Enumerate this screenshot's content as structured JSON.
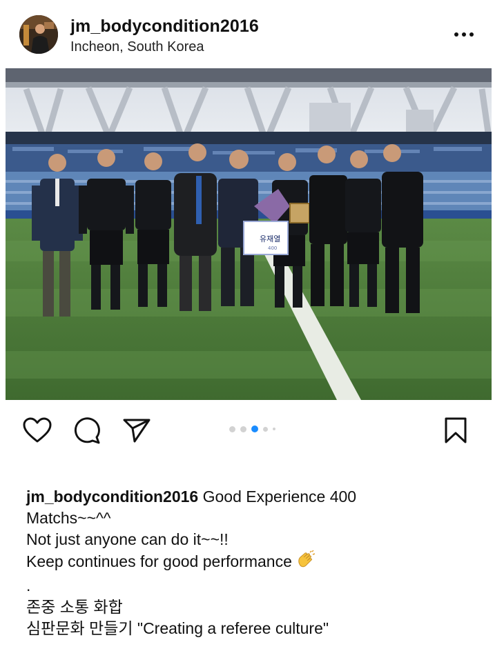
{
  "post": {
    "username": "jm_bodycondition2016",
    "location": "Incheon, South Korea"
  },
  "header": {
    "more_icon": "more-horizontal-icon"
  },
  "photo": {
    "banner_name": "유재열",
    "banner_small": "400"
  },
  "actions": {
    "like_icon": "heart-outline-icon",
    "comment_icon": "comment-bubble-icon",
    "share_icon": "paper-plane-icon",
    "save_icon": "bookmark-outline-icon",
    "carousel_total": 5,
    "carousel_active": 3,
    "active_color": "#1a8cff"
  },
  "caption": {
    "username": "jm_bodycondition2016",
    "line1": "Good Experience 400",
    "line2": "Matchs~~^^",
    "line3": "Not just anyone can do it~~!!",
    "line4": "Keep continues for good performance",
    "line4_emoji": "clapping-hands-emoji",
    "line5": ".",
    "line6": "존중 소통 화합",
    "line7": "심판문화 만들기 \"Creating a referee culture\""
  }
}
